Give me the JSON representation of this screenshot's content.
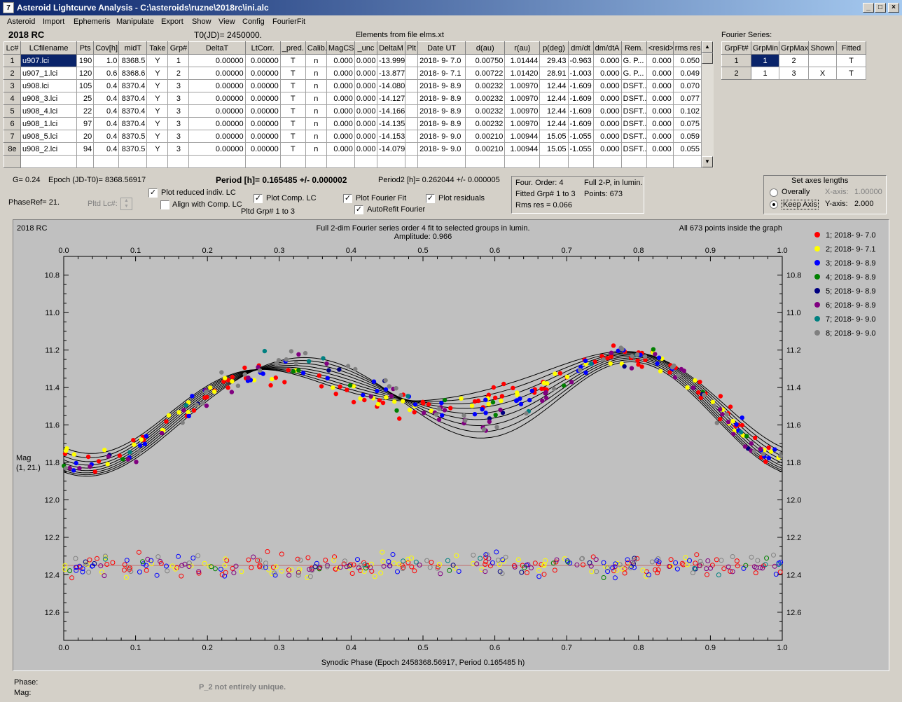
{
  "window": {
    "title": "Asteroid Lightcurve Analysis - C:\\asteroids\\ruzne\\2018rc\\ini.alc",
    "icon": "app-icon"
  },
  "menu": [
    "Asteroid",
    "Import",
    "Ephemeris",
    "Manipulate",
    "Export",
    "Show",
    "View",
    "Config",
    "FourierFit"
  ],
  "header": {
    "object": "2018 RC",
    "t0": "T0(JD)= 2450000.",
    "elements": "Elements from file elms.xt"
  },
  "lc_table": {
    "columns": [
      "Lc#",
      "LCfilename",
      "Pts",
      "Cov[h]",
      "midT",
      "Take",
      "Grp#",
      "DeltaT",
      "LtCorr.",
      "_pred.",
      "Calib.",
      "MagCS",
      "_unc",
      "DeltaM",
      "Plt",
      "Date UT",
      "d(au)",
      "r(au)",
      "p(deg)",
      "dm/dt",
      "dm/dtA",
      "Rem.",
      "<resid>",
      "rms res"
    ],
    "rows": [
      [
        "1",
        "u907.lci",
        "190",
        "1.0",
        "8368.5",
        "Y",
        "1",
        "0.00000",
        "0.00000",
        "T",
        "n",
        "0.000",
        "0.000",
        "-13.999",
        "",
        "2018- 9- 7.0",
        "0.00750",
        "1.01444",
        "29.43",
        "-0.963",
        "0.000",
        "G. P...",
        "0.000",
        "0.050"
      ],
      [
        "2",
        "u907_1.lci",
        "120",
        "0.6",
        "8368.6",
        "Y",
        "2",
        "0.00000",
        "0.00000",
        "T",
        "n",
        "0.000",
        "0.000",
        "-13.877",
        "",
        "2018- 9- 7.1",
        "0.00722",
        "1.01420",
        "28.91",
        "-1.003",
        "0.000",
        "G. P...",
        "0.000",
        "0.049"
      ],
      [
        "3",
        "u908.lci",
        "105",
        "0.4",
        "8370.4",
        "Y",
        "3",
        "0.00000",
        "0.00000",
        "T",
        "n",
        "0.000",
        "0.000",
        "-14.080",
        "",
        "2018- 9- 8.9",
        "0.00232",
        "1.00970",
        "12.44",
        "-1.609",
        "0.000",
        "DSFT...",
        "0.000",
        "0.070"
      ],
      [
        "4",
        "u908_3.lci",
        "25",
        "0.4",
        "8370.4",
        "Y",
        "3",
        "0.00000",
        "0.00000",
        "T",
        "n",
        "0.000",
        "0.000",
        "-14.127",
        "",
        "2018- 9- 8.9",
        "0.00232",
        "1.00970",
        "12.44",
        "-1.609",
        "0.000",
        "DSFT...",
        "0.000",
        "0.077"
      ],
      [
        "5",
        "u908_4.lci",
        "22",
        "0.4",
        "8370.4",
        "Y",
        "3",
        "0.00000",
        "0.00000",
        "T",
        "n",
        "0.000",
        "0.000",
        "-14.166",
        "",
        "2018- 9- 8.9",
        "0.00232",
        "1.00970",
        "12.44",
        "-1.609",
        "0.000",
        "DSFT...",
        "0.000",
        "0.102"
      ],
      [
        "6",
        "u908_1.lci",
        "97",
        "0.4",
        "8370.4",
        "Y",
        "3",
        "0.00000",
        "0.00000",
        "T",
        "n",
        "0.000",
        "0.000",
        "-14.135",
        "",
        "2018- 9- 8.9",
        "0.00232",
        "1.00970",
        "12.44",
        "-1.609",
        "0.000",
        "DSFT...",
        "0.000",
        "0.075"
      ],
      [
        "7",
        "u908_5.lci",
        "20",
        "0.4",
        "8370.5",
        "Y",
        "3",
        "0.00000",
        "0.00000",
        "T",
        "n",
        "0.000",
        "0.000",
        "-14.153",
        "",
        "2018- 9- 9.0",
        "0.00210",
        "1.00944",
        "15.05",
        "-1.055",
        "0.000",
        "DSFT...",
        "0.000",
        "0.059"
      ],
      [
        "8e",
        "u908_2.lci",
        "94",
        "0.4",
        "8370.5",
        "Y",
        "3",
        "0.00000",
        "0.00000",
        "T",
        "n",
        "0.000",
        "0.000",
        "-14.079",
        "",
        "2018- 9- 9.0",
        "0.00210",
        "1.00944",
        "15.05",
        "-1.055",
        "0.000",
        "DSFT...",
        "0.000",
        "0.055"
      ]
    ]
  },
  "fourier": {
    "label": "Fourier Series:",
    "columns": [
      "GrpFt#",
      "GrpMin",
      "GrpMax",
      "Shown",
      "Fitted"
    ],
    "rows": [
      [
        "1",
        "1",
        "2",
        "",
        "T"
      ],
      [
        "2",
        "1",
        "3",
        "X",
        "T"
      ]
    ]
  },
  "info": {
    "g": "G= 0.24",
    "epoch": "Epoch (JD-T0)= 8368.56917",
    "period": "Period [h]= 0.165485 +/- 0.000002",
    "period2": "Period2 [h]= 0.262044 +/- 0.000005",
    "phaseref": "PhaseRef= 21.",
    "pltd_lc": "Pltd Lc#:",
    "four_order": "Four. Order:  4",
    "full2p": "Full 2-P, in lumin.",
    "fitted_grp": "Fitted Grp# 1 to 3",
    "points": "Points: 673",
    "rms": "Rms res     = 0.066"
  },
  "options": {
    "plot_reduced": "Plot reduced indiv. LC",
    "align_comp": "Align with Comp. LC",
    "plot_comp": "Plot Comp. LC",
    "pltd_grp": "Pltd Grp#  1   to    3",
    "plot_fourier": "Plot Fourier Fit",
    "autorefit": "AutoRefit Fourier",
    "plot_resid": "Plot residuals",
    "plot_reduced_checked": true,
    "align_comp_checked": false,
    "plot_comp_checked": true,
    "plot_fourier_checked": true,
    "autorefit_checked": true,
    "plot_resid_checked": true
  },
  "axes_box": {
    "title": "Set axes lengths",
    "overally": "Overally",
    "keep": "Keep Axis",
    "xaxis": "X-axis:",
    "xval": "1.00000",
    "yaxis": "Y-axis:",
    "yval": "2.000",
    "selected": "keep"
  },
  "status": {
    "phase": "Phase:",
    "mag": "Mag:",
    "note": "P_2 not entirely unique."
  },
  "chart_data": {
    "type": "scatter",
    "title": "Full 2-dim Fourier series order 4 fit to selected groups in lumin.",
    "subtitle": "Amplitude: 0.966",
    "corner_left": "2018 RC",
    "corner_right": "All 673 points inside the graph",
    "xlabel": "Synodic Phase (Epoch 2458368.56917, Period 0.165485 h)",
    "ylabel": "Mag",
    "ylabel2": "(1, 21.)",
    "xlim": [
      0.0,
      1.0
    ],
    "ylim": [
      10.7,
      12.75
    ],
    "x_ticks": [
      "0.0",
      "0.1",
      "0.2",
      "0.3",
      "0.4",
      "0.5",
      "0.6",
      "0.7",
      "0.8",
      "0.9",
      "1.0"
    ],
    "y_ticks": [
      "10.8",
      "11.0",
      "11.2",
      "11.4",
      "11.6",
      "11.8",
      "12.0",
      "12.2",
      "12.4",
      "12.6"
    ],
    "residual_level": 12.35,
    "series": [
      {
        "name": "1; 2018- 9- 7.0",
        "color": "#ff0000",
        "points": 190
      },
      {
        "name": "2; 2018- 9- 7.1",
        "color": "#ffff00",
        "points": 120
      },
      {
        "name": "3; 2018- 9- 8.9",
        "color": "#0000ff",
        "points": 105
      },
      {
        "name": "4; 2018- 9- 8.9",
        "color": "#008000",
        "points": 25
      },
      {
        "name": "5; 2018- 9- 8.9",
        "color": "#000080",
        "points": 22
      },
      {
        "name": "6; 2018- 9- 8.9",
        "color": "#800080",
        "points": 97
      },
      {
        "name": "7; 2018- 9- 9.0",
        "color": "#008080",
        "points": 20
      },
      {
        "name": "8; 2018- 9- 9.0",
        "color": "#808080",
        "points": 94
      }
    ]
  }
}
